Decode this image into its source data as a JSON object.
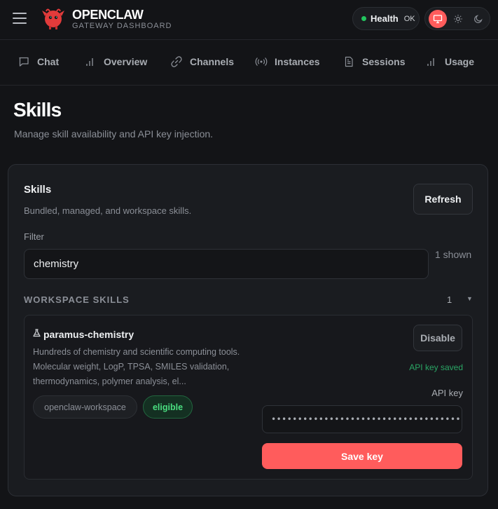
{
  "header": {
    "brand_title": "OPENCLAW",
    "brand_subtitle": "GATEWAY DASHBOARD",
    "health_label": "Health",
    "health_value": "OK",
    "logo_icon": "red-claw-mascot-icon",
    "theme_options": [
      "system",
      "light",
      "dark"
    ],
    "theme_selected": "system"
  },
  "nav": {
    "items": [
      {
        "label": "Chat",
        "icon": "chat-bubble-icon"
      },
      {
        "label": "Overview",
        "icon": "bar-chart-icon"
      },
      {
        "label": "Channels",
        "icon": "link-icon"
      },
      {
        "label": "Instances",
        "icon": "radio-waves-icon"
      },
      {
        "label": "Sessions",
        "icon": "document-icon"
      },
      {
        "label": "Usage",
        "icon": "bar-chart-icon"
      }
    ]
  },
  "page": {
    "title": "Skills",
    "subtitle": "Manage skill availability and API key injection."
  },
  "card": {
    "title": "Skills",
    "subtitle": "Bundled, managed, and workspace skills.",
    "refresh_label": "Refresh",
    "filter_label": "Filter",
    "filter_value": "chemistry",
    "shown_text": "1 shown"
  },
  "group": {
    "name": "WORKSPACE SKILLS",
    "count": "1"
  },
  "skill": {
    "emoji": "⚗",
    "name": "paramus-chemistry",
    "description": "Hundreds of chemistry and scientific computing tools. Molecular weight, LogP, TPSA, SMILES validation, thermodynamics, polymer analysis, el...",
    "source_chip": "openclaw-workspace",
    "status_chip": "eligible",
    "disable_label": "Disable",
    "key_status": "API key saved",
    "api_key_label": "API key",
    "api_key_value": "••••••••••••••••••••••••••••••••••••••••••••",
    "save_label": "Save key"
  },
  "colors": {
    "accent": "#ff5c5c",
    "ok_green": "#22c55e",
    "eligible_green": "#4ade80",
    "background": "#131417"
  }
}
